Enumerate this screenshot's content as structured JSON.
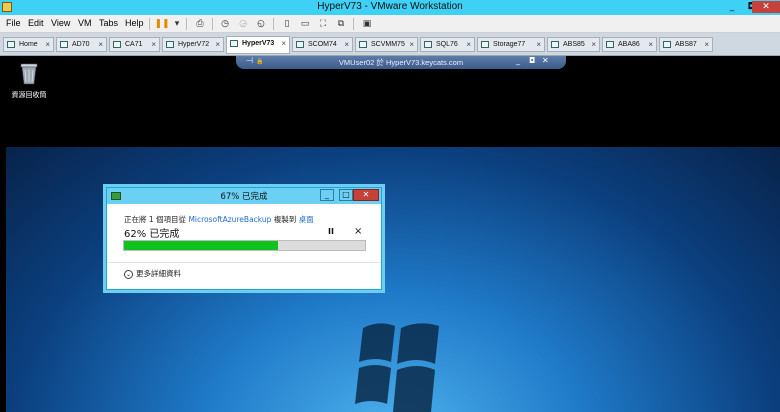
{
  "window": {
    "title": "HyperV73 - VMware Workstation",
    "minimize": "_",
    "restore": "◘",
    "close": "✕"
  },
  "menu": {
    "items": [
      "File",
      "Edit",
      "View",
      "VM",
      "Tabs",
      "Help"
    ]
  },
  "tabs": [
    {
      "label": "Home",
      "close": "×"
    },
    {
      "label": "AD70",
      "close": "×"
    },
    {
      "label": "CA71",
      "close": "×"
    },
    {
      "label": "HyperV72",
      "close": "×"
    },
    {
      "label": "HyperV73",
      "close": "×"
    },
    {
      "label": "SCOM74",
      "close": "×"
    },
    {
      "label": "SCVMM75",
      "close": "×"
    },
    {
      "label": "SQL76",
      "close": "×"
    },
    {
      "label": "Storage77",
      "close": "×"
    },
    {
      "label": "ABS85",
      "close": "×"
    },
    {
      "label": "ABA86",
      "close": "×"
    },
    {
      "label": "ABS87",
      "close": "×"
    }
  ],
  "vmbar": {
    "label": "VMUser02 於 HyperV73.keycats.com",
    "pin": "⊣",
    "lock": "🔒",
    "min": "_",
    "restore": "◘",
    "close": "✕"
  },
  "desktop": {
    "recycle_label": "資源回收筒"
  },
  "dialog": {
    "title": "67% 已完成",
    "line_prefix": "正在將 1 個項目從 ",
    "source": "MicrosoftAzureBackup",
    "line_mid": " 複製到 ",
    "dest": "桌面",
    "percent_text": "62% 已完成",
    "pause": "II",
    "cancel": "×",
    "progress": 0.64,
    "more_details": "更多詳細資料",
    "minimize": "_",
    "maximize": "□",
    "close": "✕"
  },
  "colors": {
    "titlebar": "#3fd0f5",
    "progress": "#10c21d",
    "link": "#1e6fc8"
  }
}
